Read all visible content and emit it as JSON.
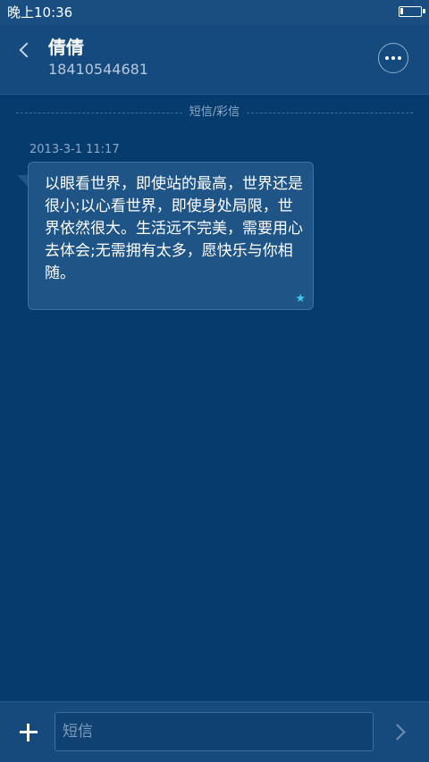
{
  "status_bar": {
    "time": "晚上10:36",
    "battery_icon": "battery-icon"
  },
  "header": {
    "contact_name": "倩倩",
    "contact_number": "18410544681",
    "back_icon": "chevron-left-icon",
    "more_icon": "more-dots-icon"
  },
  "conversation": {
    "divider_label": "短信/彩信",
    "messages": [
      {
        "time": "2013-3-1 11:17",
        "text": "以眼看世界，即使站的最高，世界还是很小;以心看世界，即使身处局限，世界依然很大。生活远不完美，需要用心去体会;无需拥有太多，愿快乐与你相随。",
        "star_icon": "star-icon",
        "starred": true
      }
    ]
  },
  "input_bar": {
    "placeholder": "短信",
    "value": "",
    "add_icon": "plus-icon",
    "send_icon": "chevron-right-icon"
  },
  "colors": {
    "background": "#063b6e",
    "header": "#144a7d",
    "bubble": "#1f5486",
    "star": "#3cc8f0"
  }
}
